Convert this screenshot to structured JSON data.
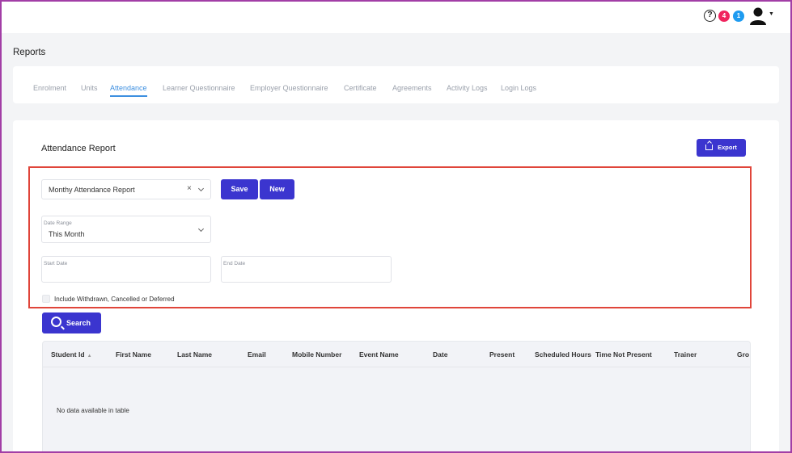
{
  "topbar": {
    "help_icon": "?",
    "notif_red": "4",
    "notif_blue": "1",
    "colors": {
      "red_badge": "#f0245e",
      "blue_badge": "#1e9bf0"
    }
  },
  "page": {
    "title": "Reports"
  },
  "tabs": [
    {
      "label": "Enrolment",
      "active": false
    },
    {
      "label": "Units",
      "active": false
    },
    {
      "label": "Attendance",
      "active": true
    },
    {
      "label": "Learner Questionnaire",
      "active": false
    },
    {
      "label": "Employer Questionnaire",
      "active": false
    },
    {
      "label": "Certificate",
      "active": false
    },
    {
      "label": "Agreements",
      "active": false
    },
    {
      "label": "Activity Logs",
      "active": false
    },
    {
      "label": "Login Logs",
      "active": false
    }
  ],
  "report": {
    "title": "Attendance Report",
    "export_label": "Export",
    "selected_report": "Monthy Attendance Report",
    "clear_symbol": "×",
    "save_label": "Save",
    "new_label": "New",
    "date_range_label": "Date Range",
    "date_range_value": "This Month",
    "start_date_label": "Start Date",
    "end_date_label": "End Date",
    "include_label": "Include Withdrawn, Cancelled or Deferred",
    "include_checked": false,
    "search_label": "Search"
  },
  "table": {
    "columns": [
      "Student Id",
      "First Name",
      "Last Name",
      "Email",
      "Mobile Number",
      "Event Name",
      "Date",
      "Present",
      "Scheduled Hours",
      "Time Not Present",
      "Trainer",
      "Gro"
    ],
    "empty_message": "No data available in table"
  },
  "colors": {
    "primary": "#3b35cf",
    "active_tab": "#3d8fe0",
    "highlight": "#e0453a",
    "frame": "#a23ea6"
  }
}
